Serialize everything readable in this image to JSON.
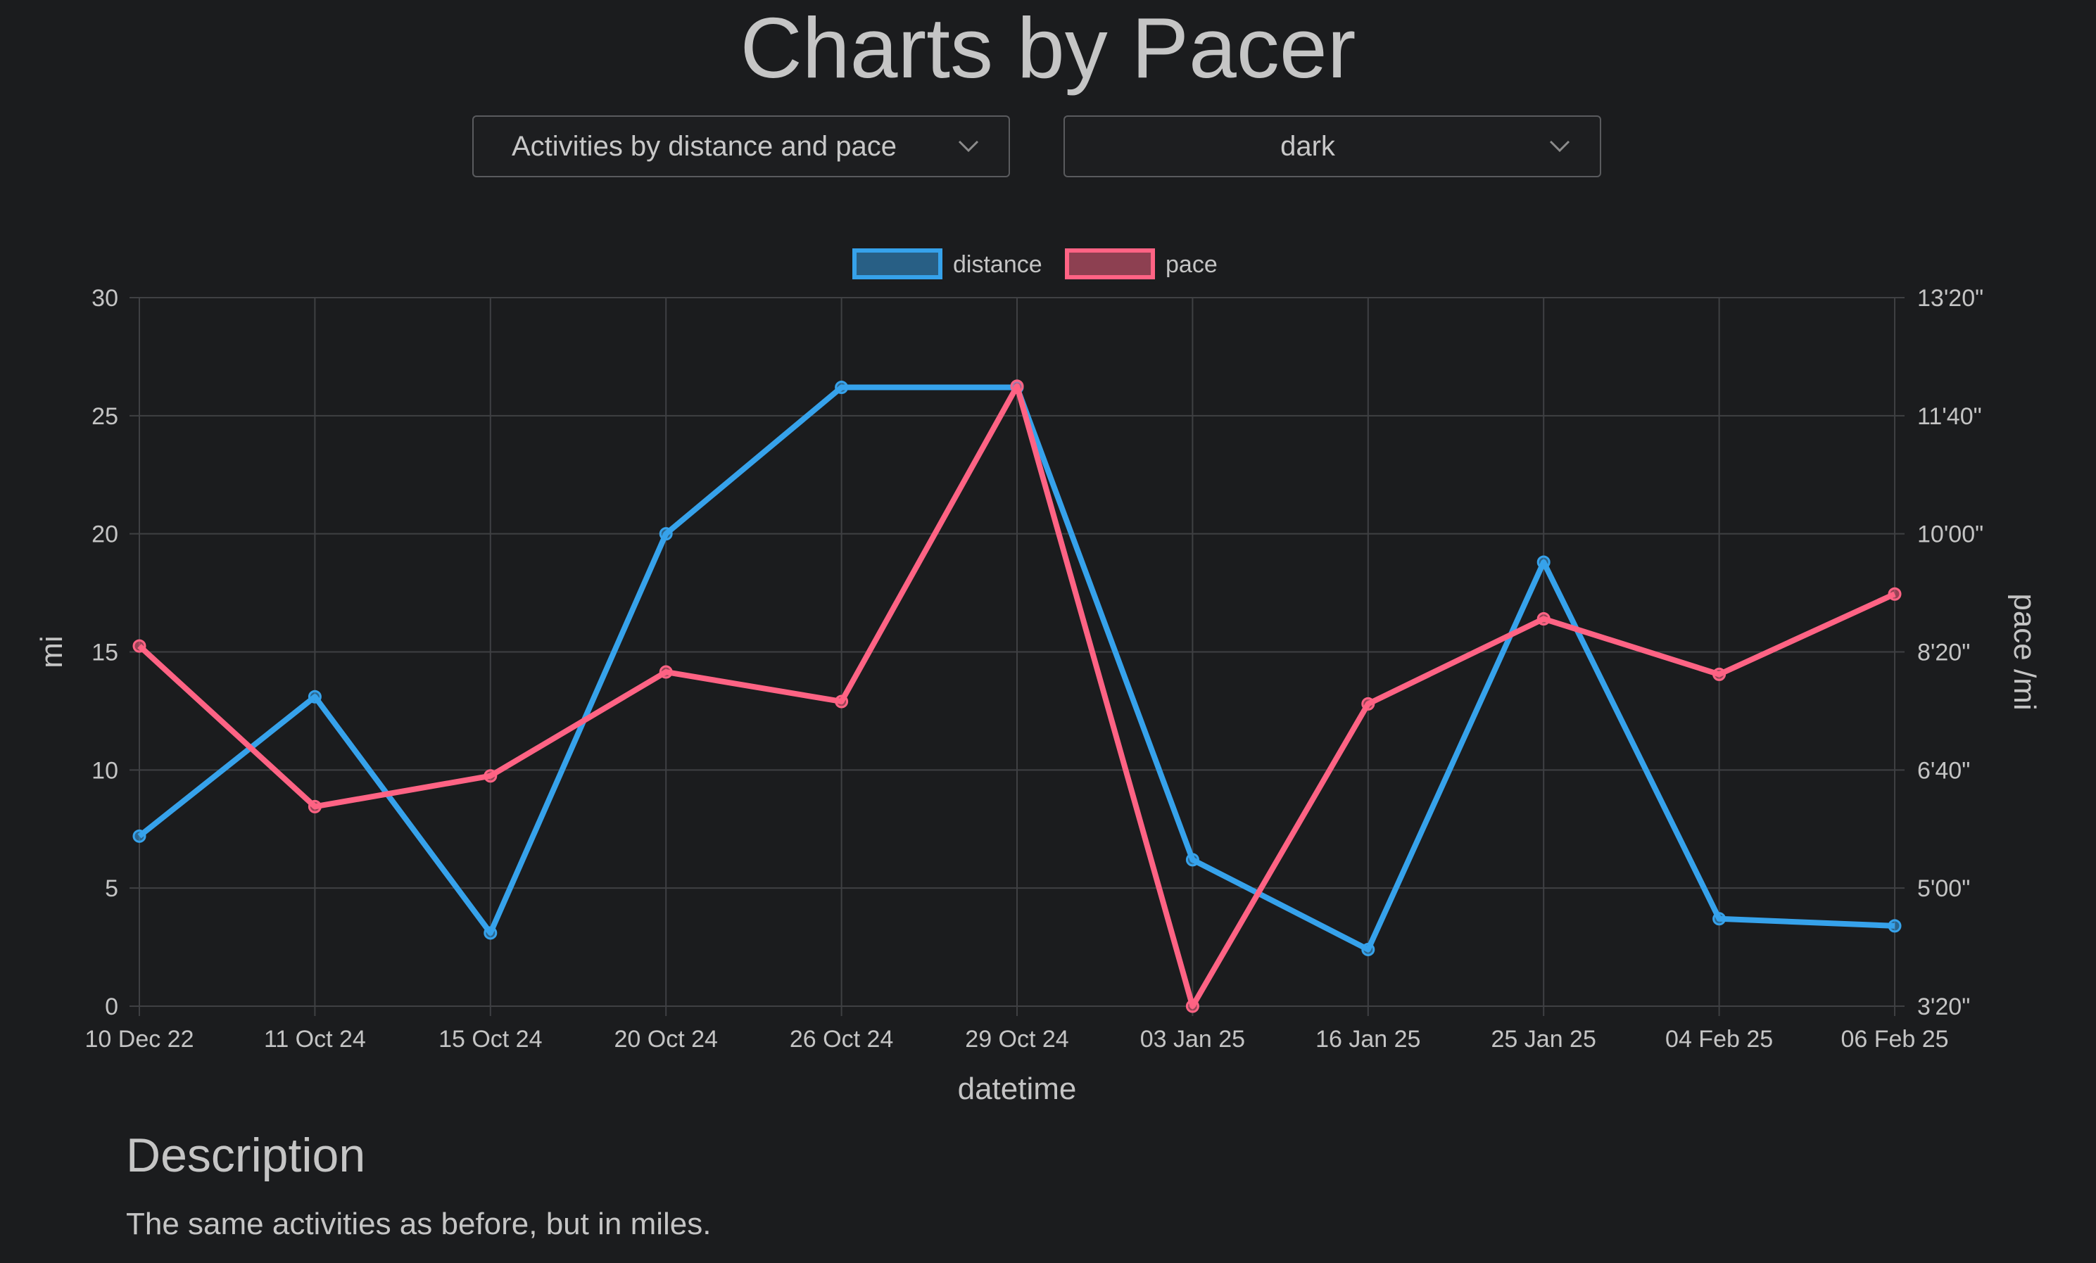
{
  "page": {
    "title": "Charts by Pacer",
    "chart_select": "Activities by distance and pace",
    "theme_select": "dark",
    "description_heading": "Description",
    "description_text": "The same activities as before, but in miles.",
    "icons": {
      "dropdown": "chevron-down-icon"
    }
  },
  "colors": {
    "background": "#1b1c1e",
    "grid": "#3f4043",
    "text": "#c4c4c4",
    "distance": "#36a2eb",
    "pace": "#ff6384"
  },
  "chart_data": {
    "type": "line",
    "title": "",
    "legend_position": "top",
    "grid": true,
    "categories": [
      "10 Dec 22",
      "11 Oct 24",
      "15 Oct 24",
      "20 Oct 24",
      "26 Oct 24",
      "29 Oct 24",
      "03 Jan 25",
      "16 Jan 25",
      "25 Jan 25",
      "04 Feb 25",
      "06 Feb 25"
    ],
    "xlabel": "datetime",
    "y_left": {
      "label": "mi",
      "range": [
        0,
        30
      ],
      "ticks": [
        "0",
        "5",
        "10",
        "15",
        "20",
        "25",
        "30"
      ]
    },
    "y_right": {
      "label": "pace /mi",
      "range_seconds": [
        200,
        800
      ],
      "ticks": [
        "3'20\"",
        "5'00\"",
        "6'40\"",
        "8'20\"",
        "10'00\"",
        "11'40\"",
        "13'20\""
      ]
    },
    "series": [
      {
        "name": "distance",
        "axis": "left",
        "unit": "mi",
        "values": [
          7.2,
          13.1,
          3.1,
          20.0,
          26.2,
          26.2,
          6.2,
          2.4,
          18.8,
          3.7,
          3.4
        ]
      },
      {
        "name": "pace",
        "axis": "right",
        "unit": "seconds per mi",
        "values": [
          505,
          369,
          395,
          483,
          458,
          725,
          200,
          456,
          528,
          481,
          549
        ]
      }
    ]
  }
}
